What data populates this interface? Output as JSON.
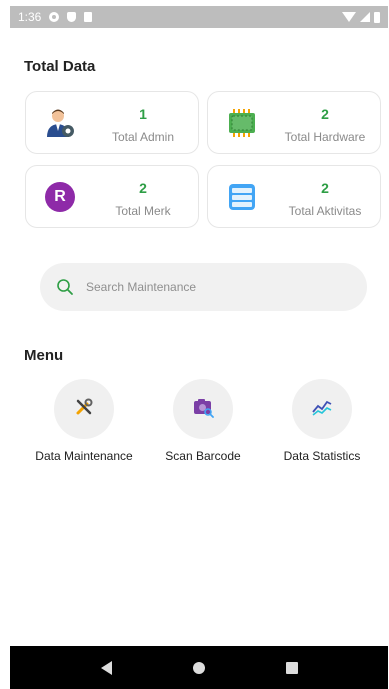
{
  "status_bar": {
    "time": "1:36",
    "icons": [
      "settings-icon",
      "shield-icon",
      "sd-card-icon",
      "wifi-icon",
      "signal-icon",
      "battery-icon"
    ]
  },
  "total_section": {
    "title": "Total Data",
    "cards": [
      {
        "value": "1",
        "label": "Total Admin",
        "icon": "admin-user-icon"
      },
      {
        "value": "2",
        "label": "Total Hardware",
        "icon": "chip-icon"
      },
      {
        "value": "2",
        "label": "Total Merk",
        "icon": "brand-r-icon",
        "icon_letter": "R"
      },
      {
        "value": "2",
        "label": "Total Aktivitas",
        "icon": "list-icon"
      }
    ]
  },
  "search": {
    "placeholder": "Search Maintenance",
    "value": ""
  },
  "menu_section": {
    "title": "Menu",
    "items": [
      {
        "label": "Data Maintenance",
        "icon": "tools-icon"
      },
      {
        "label": "Scan Barcode",
        "icon": "camera-scan-icon"
      },
      {
        "label": "Data Statistics",
        "icon": "chart-line-icon"
      }
    ]
  },
  "colors": {
    "value_green": "#2e9e45",
    "merk_purple": "#8e2aa8",
    "list_blue": "#42a5f5",
    "chip_green": "#4caf50"
  }
}
